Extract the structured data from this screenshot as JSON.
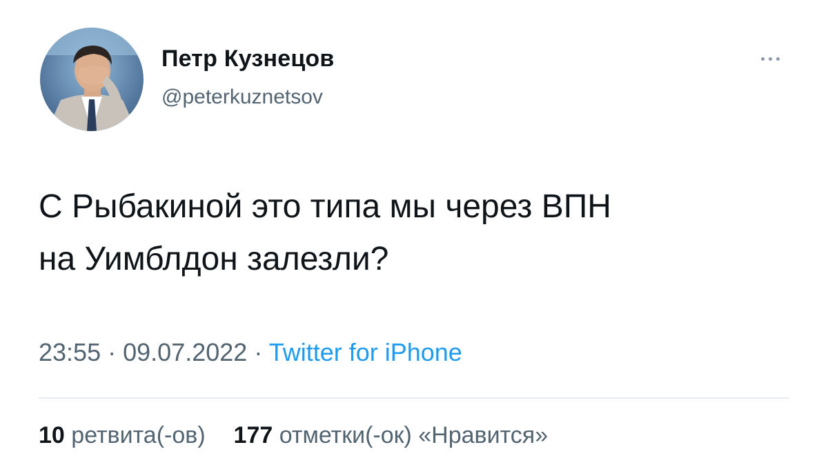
{
  "author": {
    "name": "Петр Кузнецов",
    "handle": "@peterkuznetsov"
  },
  "tweet": {
    "lines": [
      "С Рыбакиной это типа мы через ВПН",
      "на Уимблдон залезли?"
    ]
  },
  "meta": {
    "time": "23:55",
    "separator": "·",
    "date": "09.07.2022",
    "source": "Twitter for iPhone"
  },
  "stats": {
    "retweets_count": "10",
    "retweets_label": "ретвита(-ов)",
    "likes_count": "177",
    "likes_label": "отметки(-ок) «Нравится»"
  },
  "icons": {
    "more": "more-horizontal-icon"
  },
  "colors": {
    "text": "#0f1419",
    "secondary": "#536471",
    "link": "#1d9bf0",
    "divider": "#e6ecf0"
  }
}
